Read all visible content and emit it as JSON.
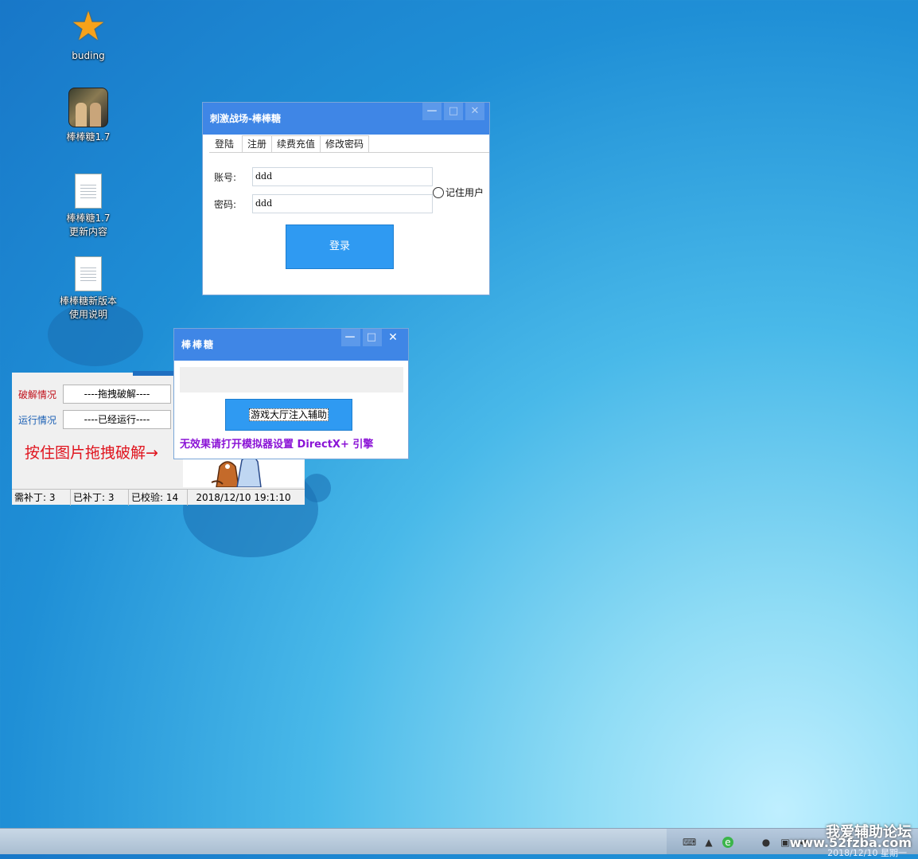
{
  "desktop": {
    "icons": [
      {
        "label": "buding"
      },
      {
        "label": "棒棒糖1.7"
      },
      {
        "label": "棒棒糖1.7更新内容"
      },
      {
        "label": "棒棒糖新版本使用说明"
      }
    ]
  },
  "login_window": {
    "title": "刺激战场-棒棒糖",
    "controls": {
      "minimize": "—",
      "maximize": "□",
      "close": "✕"
    },
    "tabs": [
      "登陆",
      "注册",
      "续费充值",
      "修改密码"
    ],
    "account_label": "账号:",
    "account_value": "ddd",
    "password_label": "密码:",
    "password_value": "ddd",
    "remember_label": "记住用户",
    "login_button": "登录"
  },
  "injector_window": {
    "title": "棒棒糖",
    "controls": {
      "minimize": "—",
      "maximize": "□",
      "close": "✕"
    },
    "inject_button": "游戏大厅注入辅助",
    "warning": "无效果请打开模拟器设置 DirectX+ 引擎"
  },
  "crack_window": {
    "crack_label": "破解情况",
    "crack_value": "----拖拽破解----",
    "run_label": "运行情况",
    "run_value": "----已经运行----",
    "hint": "按住图片拖拽破解→",
    "status": {
      "need_patch": "需补丁: 3",
      "patched": "已补丁: 3",
      "verified": "已校验: 14",
      "datetime": "2018/12/10 19:1:10"
    }
  },
  "taskbar": {
    "watermark": "我爱辅助论坛",
    "watermark_url": "www.52fzba.com",
    "clock": "2018/12/10 星期一"
  },
  "colors": {
    "title_bar": "#3f86e6",
    "button": "#2f9af2",
    "warning_text": "#8b14d6",
    "hint_text": "#e0141e"
  }
}
